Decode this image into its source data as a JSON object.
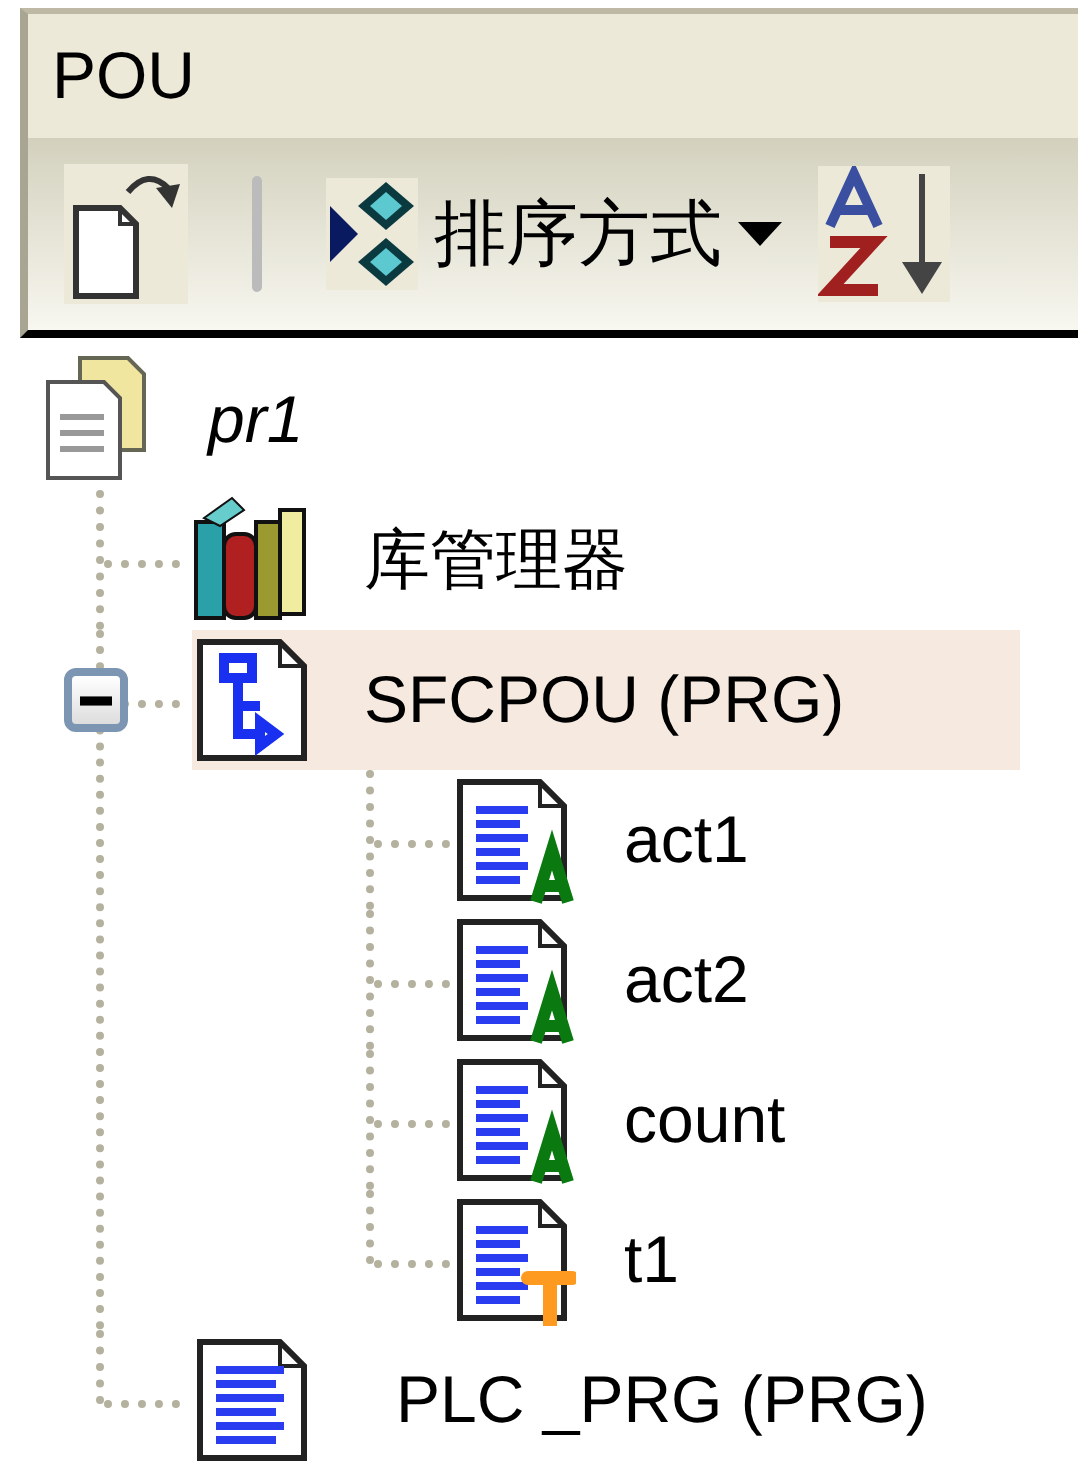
{
  "panel": {
    "title": "POU"
  },
  "toolbar": {
    "sort_menu": {
      "label": "排序方式"
    }
  },
  "tree": {
    "label": "pr1",
    "kind": "project",
    "selected": false,
    "children": [
      {
        "label": "库管理器",
        "kind": "library",
        "selected": false
      },
      {
        "label": "SFCPOU (PRG)",
        "kind": "sfc",
        "selected": true,
        "expanded": true,
        "children": [
          {
            "label": "act1",
            "kind": "action",
            "selected": false
          },
          {
            "label": "act2",
            "kind": "action",
            "selected": false
          },
          {
            "label": "count",
            "kind": "action",
            "selected": false
          },
          {
            "label": "t1",
            "kind": "transition",
            "selected": false
          }
        ]
      },
      {
        "label": "PLC _PRG (PRG)",
        "kind": "program",
        "selected": false
      }
    ]
  }
}
